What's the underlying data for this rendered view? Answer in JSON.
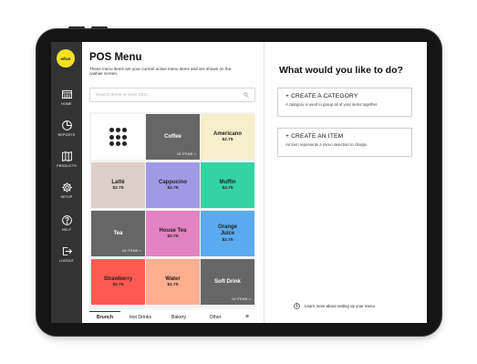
{
  "brand": {
    "logo_text": "eðun"
  },
  "sidebar": {
    "items": [
      {
        "label": "HOME",
        "icon": "store-icon"
      },
      {
        "label": "REPORTS",
        "icon": "pie-chart-icon"
      },
      {
        "label": "PRODUCTS",
        "icon": "map-icon"
      },
      {
        "label": "SETUP",
        "icon": "gear-icon"
      },
      {
        "label": "HELP",
        "icon": "help-icon"
      },
      {
        "label": "LOGOUT",
        "icon": "logout-icon"
      }
    ]
  },
  "menu": {
    "title": "POS Menu",
    "subtitle": "These menu items are your current active menu items and are shown on the cashier screen.",
    "search_placeholder": "Search Items or scan SKU...",
    "tiles": [
      {
        "name": "",
        "price": "",
        "count": "",
        "color": "#ffffff",
        "text_color": "#222222",
        "icon": "grid-dots-icon"
      },
      {
        "name": "Coffee",
        "price": "",
        "count": "16 ITEMS >",
        "color": "#666666",
        "text_color": "#ffffff"
      },
      {
        "name": "Americano",
        "price": "$2.75",
        "count": "",
        "color": "#f7efcb",
        "text_color": "#222222"
      },
      {
        "name": "Latté",
        "price": "$2.75",
        "count": "",
        "color": "#dccfc7",
        "text_color": "#222222"
      },
      {
        "name": "Cappucino",
        "price": "$2.75",
        "count": "",
        "color": "#a09ae6",
        "text_color": "#222222"
      },
      {
        "name": "Muffin",
        "price": "$2.75",
        "count": "",
        "color": "#34d3a3",
        "text_color": "#222222"
      },
      {
        "name": "Tea",
        "price": "",
        "count": "23 ITEMS >",
        "color": "#666666",
        "text_color": "#ffffff"
      },
      {
        "name": "House Tea",
        "price": "$2.75",
        "count": "",
        "color": "#e483c2",
        "text_color": "#222222"
      },
      {
        "name": "Orange Juice",
        "price": "$2.75",
        "count": "",
        "color": "#5aaaf0",
        "text_color": "#222222"
      },
      {
        "name": "Strawberry",
        "price": "$2.75",
        "count": "",
        "color": "#ff5a52",
        "text_color": "#222222"
      },
      {
        "name": "Water",
        "price": "$2.75",
        "count": "",
        "color": "#ffae90",
        "text_color": "#222222"
      },
      {
        "name": "Soft Drink",
        "price": "",
        "count": "13 ITEMS >",
        "color": "#666666",
        "text_color": "#ffffff"
      }
    ],
    "category_tabs": [
      {
        "label": "Brunch",
        "active": true
      },
      {
        "label": "Hot Drinks",
        "active": false
      },
      {
        "label": "Bakery",
        "active": false
      },
      {
        "label": "Other",
        "active": false
      },
      {
        "label": "≡",
        "active": false
      }
    ]
  },
  "actions": {
    "question": "What would you like to do?",
    "create_category": {
      "title": "+ CREATE A CATEGORY",
      "desc": "A category is used to group all of your items together."
    },
    "create_item": {
      "title": "+ CREATE AN ITEM",
      "desc": "An item represents a menu selection to charge."
    },
    "learn_more": "Learn more about setting up your menu"
  }
}
